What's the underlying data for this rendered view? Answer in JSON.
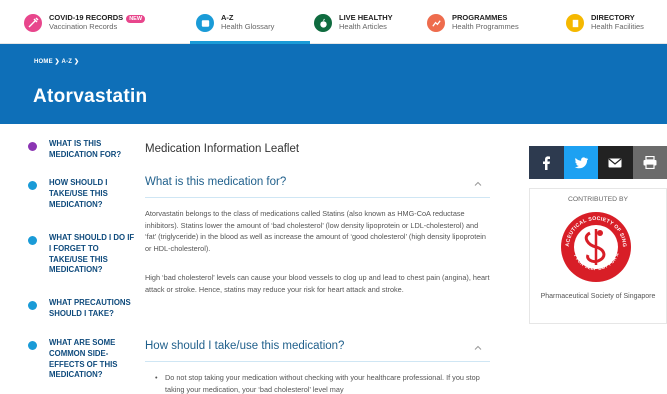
{
  "topnav": {
    "items": [
      {
        "title": "COVID-19 RECORDS",
        "badge": "NEW",
        "sub": "Vaccination Records",
        "color": "#e8468c",
        "icon": "syringe-icon"
      },
      {
        "title": "A-Z",
        "sub": "Health Glossary",
        "color": "#1a9bd7",
        "icon": "book-icon"
      },
      {
        "title": "LIVE HEALTHY",
        "sub": "Health Articles",
        "color": "#0f6b3f",
        "icon": "heart-apple-icon"
      },
      {
        "title": "PROGRAMMES",
        "sub": "Health Programmes",
        "color": "#ee6c4d",
        "icon": "programme-icon"
      },
      {
        "title": "DIRECTORY",
        "sub": "Health Facilities",
        "color": "#f5b800",
        "icon": "building-icon"
      }
    ],
    "active_color": "#1a9bd7"
  },
  "banner": {
    "breadcrumb": "HOME ❯ A-Z ❯",
    "title": "Atorvastatin",
    "color": "#0e6fb8"
  },
  "toc": {
    "items": [
      {
        "label": "WHAT IS THIS MEDICATION FOR?",
        "active": true
      },
      {
        "label": "HOW SHOULD I TAKE/USE THIS MEDICATION?",
        "active": false
      },
      {
        "label": "WHAT SHOULD I DO IF I FORGET TO TAKE/USE THIS MEDICATION?",
        "active": false
      },
      {
        "label": "WHAT PRECAUTIONS SHOULD I TAKE?",
        "active": false
      },
      {
        "label": "WHAT ARE SOME COMMON SIDE-EFFECTS OF THIS MEDICATION?",
        "active": false
      }
    ]
  },
  "main": {
    "leaflet_title": "Medication Information Leaflet",
    "section1": {
      "heading": "What is this medication for?",
      "para1": "Atorvastatin belongs to the class of medications called Statins (also known as HMG-CoA reductase inhibitors). Statins lower the amount of ‘bad cholesterol’ (low density lipoprotein or LDL-cholesterol) and ‘fat’ (triglyceride) in the blood as well as increase the amount of ‘good cholesterol’ (high density lipoprotein or HDL-cholesterol).",
      "para2": "High ‘bad cholesterol’ levels can cause your blood vessels to clog up and lead to chest pain (angina), heart attack or stroke. Hence, statins may reduce your risk for heart attack and stroke."
    },
    "section2": {
      "heading": "How should I take/use this medication?",
      "bullet1": "Do not stop taking your medication without checking with your healthcare professional. If you stop taking your medication, your ‘bad cholesterol’ level may"
    }
  },
  "share": {
    "buttons": [
      {
        "icon": "facebook-icon",
        "color": "#2d3a4f"
      },
      {
        "icon": "twitter-icon",
        "color": "#1da1f2"
      },
      {
        "icon": "email-icon",
        "color": "#222222"
      },
      {
        "icon": "print-icon",
        "color": "#6b6b6b"
      }
    ]
  },
  "contributed": {
    "label": "CONTRIBUTED BY",
    "org_name": "Pharmaceutical Society of Singapore",
    "seal_color": "#d81e27",
    "seal_top_text": "PHARMACEUTICAL SOCIETY OF SINGAPORE",
    "seal_bottom_text": "NOT FOR SELF BUT FOR ALL"
  }
}
